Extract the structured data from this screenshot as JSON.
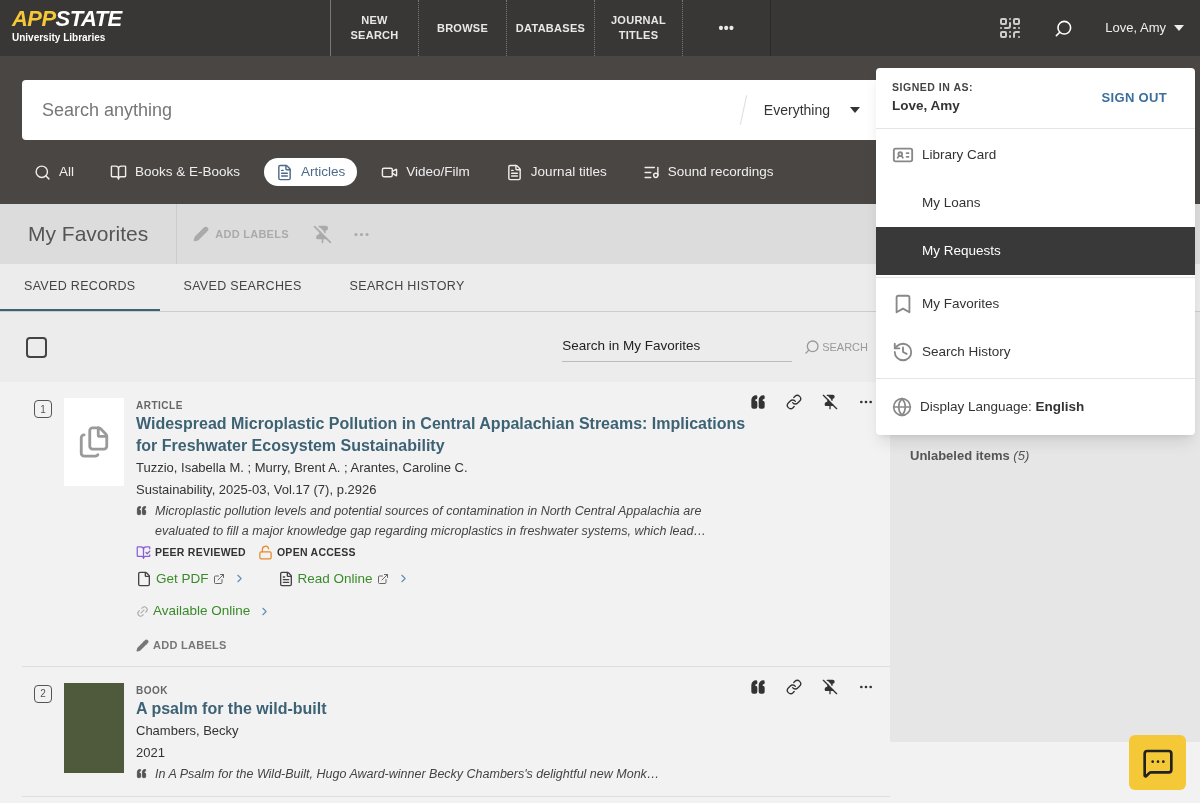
{
  "header": {
    "logo": {
      "words": [
        "APP",
        "STATE"
      ],
      "subtitle": "University Libraries"
    },
    "nav": [
      {
        "label": "NEW SEARCH",
        "kind": "text"
      },
      {
        "label": "BROWSE",
        "kind": "text"
      },
      {
        "label": "DATABASES",
        "kind": "text"
      },
      {
        "label": "JOURNAL TITLES",
        "kind": "text"
      },
      {
        "label": "•••",
        "kind": "more"
      }
    ],
    "user": "Love, Amy"
  },
  "search": {
    "placeholder": "Search anything",
    "scope": "Everything"
  },
  "filters": [
    {
      "label": "All",
      "kind": "search",
      "selected": false
    },
    {
      "label": "Books & E-Books",
      "kind": "book",
      "selected": false
    },
    {
      "label": "Articles",
      "kind": "article",
      "selected": true
    },
    {
      "label": "Video/Film",
      "kind": "video",
      "selected": false
    },
    {
      "label": "Journal titles",
      "kind": "journal",
      "selected": false
    },
    {
      "label": "Sound recordings",
      "kind": "sound",
      "selected": false
    }
  ],
  "favorites": {
    "title": "My Favorites",
    "add_labels": "ADD LABELS"
  },
  "tabs": [
    {
      "label": "SAVED RECORDS",
      "selected": true
    },
    {
      "label": "SAVED SEARCHES",
      "selected": false
    },
    {
      "label": "SEARCH HISTORY",
      "selected": false
    }
  ],
  "list_search": {
    "placeholder": "Search in My Favorites",
    "button": "SEARCH",
    "select_all": {
      "checked": false
    }
  },
  "side_panel": {
    "label": "Unlabeled items",
    "count": "(5)"
  },
  "records": [
    {
      "index": "1",
      "kind": "article",
      "type": "ARTICLE",
      "title": "Widespread Microplastic Pollution in Central Appalachian Streams: Implications for Freshwater Ecosystem Sustainability",
      "authors": "Tuzzio, Isabella M. ; Murry, Brent A. ; Arantes, Caroline C.",
      "source": "Sustainability, 2025-03, Vol.17 (7), p.2926",
      "snippet": "Microplastic pollution levels and potential sources of contamination in North Central Appalachia are evaluated to fill a major knowledge gap regarding microplastics in freshwater systems, which lead…",
      "badges": [
        {
          "label": "PEER REVIEWED",
          "kind": "peer"
        },
        {
          "label": "OPEN ACCESS",
          "kind": "open"
        }
      ],
      "links": [
        {
          "label": "Get PDF",
          "kind": "pdf"
        },
        {
          "label": "Read Online",
          "kind": "read"
        }
      ],
      "availability": "Available Online",
      "add_labels": "ADD LABELS"
    },
    {
      "index": "2",
      "kind": "book",
      "type": "BOOK",
      "title": "A psalm for the wild-built",
      "authors": "Chambers, Becky",
      "source": "2021",
      "snippet": "In A Psalm for the Wild-Built, Hugo Award-winner Becky Chambers's delightful new Monk…"
    }
  ],
  "user_menu": {
    "signed_in_label": "SIGNED IN AS:",
    "user": "Love, Amy",
    "sign_out": "SIGN OUT",
    "groups": [
      [
        {
          "label": "Library Card",
          "kind": "card",
          "selected": false
        },
        {
          "label": "My Loans",
          "kind": "plain",
          "selected": false
        },
        {
          "label": "My Requests",
          "kind": "plain",
          "selected": true
        }
      ],
      [
        {
          "label": "My Favorites",
          "kind": "bookmark",
          "selected": false
        },
        {
          "label": "Search History",
          "kind": "history",
          "selected": false
        }
      ]
    ],
    "language": "Display Language: **English**"
  }
}
